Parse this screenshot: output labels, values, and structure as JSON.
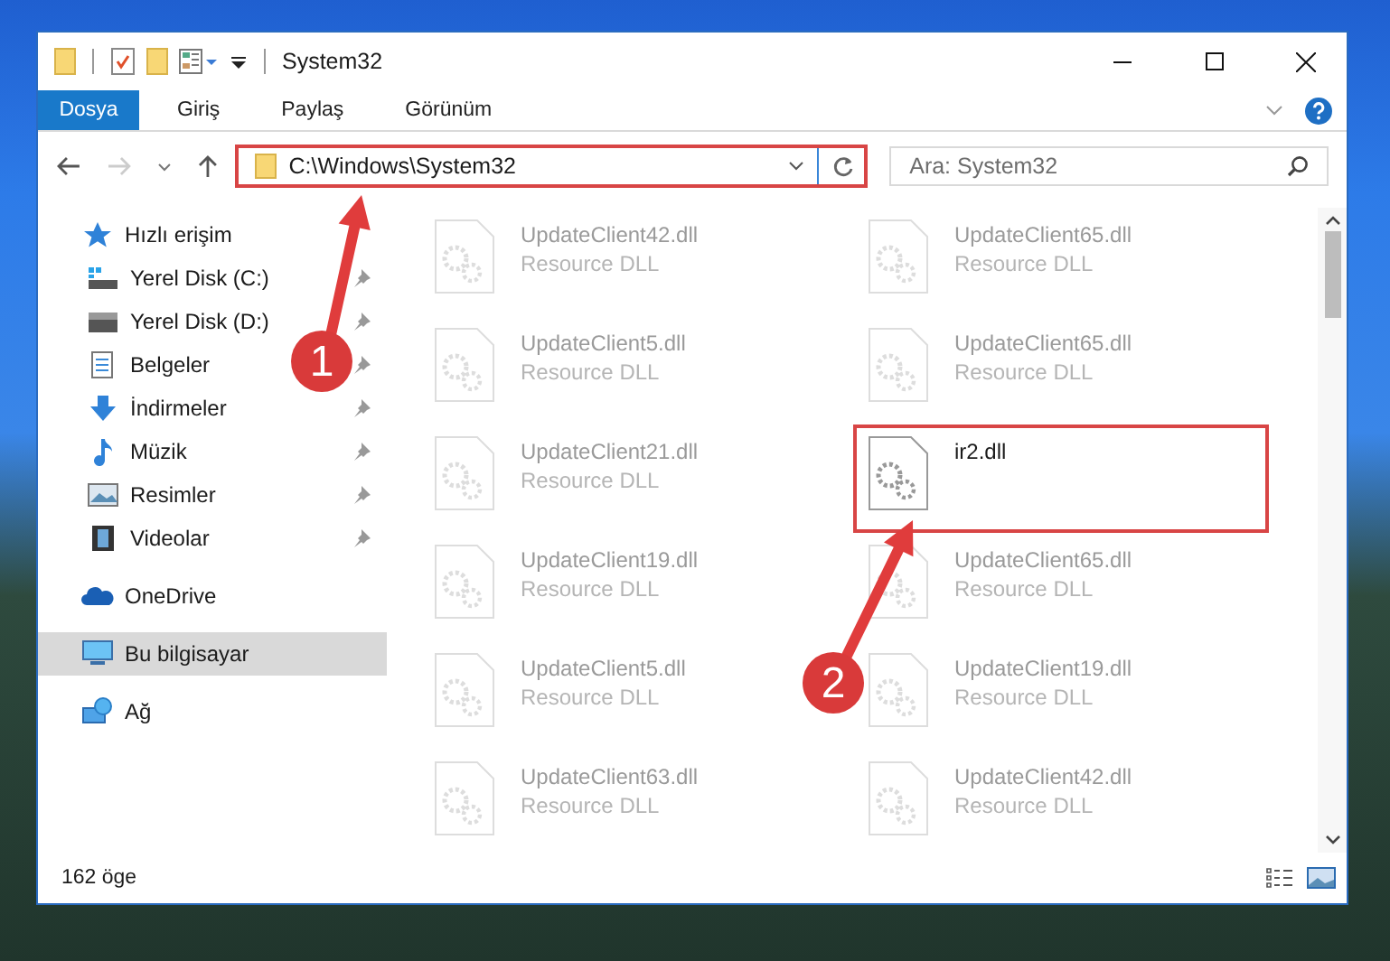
{
  "window": {
    "title": "System32"
  },
  "ribbon_tabs": [
    {
      "label": "Dosya",
      "selected": true
    },
    {
      "label": "Giriş",
      "selected": false
    },
    {
      "label": "Paylaş",
      "selected": false
    },
    {
      "label": "Görünüm",
      "selected": false
    }
  ],
  "address_bar": {
    "path": "C:\\Windows\\System32",
    "highlighted": true
  },
  "search": {
    "placeholder": "Ara: System32"
  },
  "sidebar": {
    "items": [
      {
        "label": "Hızlı erişim",
        "kind": "star",
        "selected": false,
        "children": [
          {
            "label": "Yerel Disk (C:)",
            "kind": "system-drive",
            "pinned": true,
            "selected": false
          },
          {
            "label": "Yerel Disk (D:)",
            "kind": "drive",
            "pinned": true,
            "selected": false
          },
          {
            "label": "Belgeler",
            "kind": "documents",
            "pinned": true,
            "selected": false
          },
          {
            "label": "İndirmeler",
            "kind": "downloads",
            "pinned": true,
            "selected": false
          },
          {
            "label": "Müzik",
            "kind": "music",
            "pinned": true,
            "selected": false
          },
          {
            "label": "Resimler",
            "kind": "pictures",
            "pinned": true,
            "selected": false
          },
          {
            "label": "Videolar",
            "kind": "videos",
            "pinned": true,
            "selected": false
          }
        ]
      },
      {
        "label": "OneDrive",
        "kind": "cloud",
        "selected": false
      },
      {
        "label": "Bu bilgisayar",
        "kind": "computer",
        "selected": true
      },
      {
        "label": "Ağ",
        "kind": "network",
        "selected": false
      }
    ]
  },
  "files": [
    {
      "name": "UpdateClient42.dll",
      "type": "Resource DLL",
      "dimmed": true,
      "highlighted": false
    },
    {
      "name": "UpdateClient65.dll",
      "type": "Resource DLL",
      "dimmed": true,
      "highlighted": false
    },
    {
      "name": "UpdateClient5.dll",
      "type": "Resource DLL",
      "dimmed": true,
      "highlighted": false
    },
    {
      "name": "UpdateClient65.dll",
      "type": "Resource DLL",
      "dimmed": true,
      "highlighted": false
    },
    {
      "name": "UpdateClient21.dll",
      "type": "Resource DLL",
      "dimmed": true,
      "highlighted": false
    },
    {
      "name": "ir2.dll",
      "dimmed": false,
      "highlighted": true
    },
    {
      "name": "UpdateClient19.dll",
      "type": "Resource DLL",
      "dimmed": true,
      "highlighted": false
    },
    {
      "name": "UpdateClient65.dll",
      "type": "Resource DLL",
      "dimmed": true,
      "highlighted": false
    },
    {
      "name": "UpdateClient5.dll",
      "type": "Resource DLL",
      "dimmed": true,
      "highlighted": false
    },
    {
      "name": "UpdateClient19.dll",
      "type": "Resource DLL",
      "dimmed": true,
      "highlighted": false
    },
    {
      "name": "UpdateClient63.dll",
      "type": "Resource DLL",
      "dimmed": true,
      "highlighted": false
    },
    {
      "name": "UpdateClient42.dll",
      "type": "Resource DLL",
      "dimmed": true,
      "highlighted": false
    }
  ],
  "callouts": [
    {
      "label": "1"
    },
    {
      "label": "2"
    }
  ],
  "status_bar": {
    "count": "162 öge"
  }
}
